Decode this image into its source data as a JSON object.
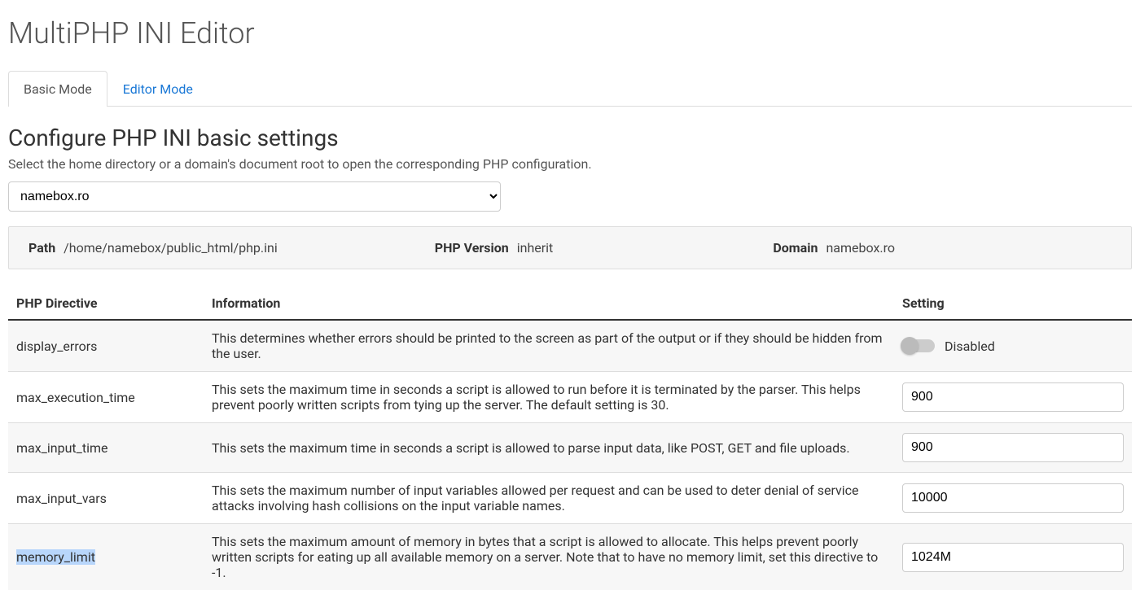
{
  "page": {
    "title": "MultiPHP INI Editor",
    "tabs": [
      {
        "label": "Basic Mode",
        "active": true
      },
      {
        "label": "Editor Mode",
        "active": false
      }
    ],
    "section_title": "Configure PHP INI basic settings",
    "helptext": "Select the home directory or a domain's document root to open the corresponding PHP configuration.",
    "domain_selected": "namebox.ro"
  },
  "info": {
    "path_label": "Path",
    "path_value": "/home/namebox/public_html/php.ini",
    "version_label": "PHP Version",
    "version_value": "inherit",
    "domain_label": "Domain",
    "domain_value": "namebox.ro"
  },
  "table": {
    "headers": {
      "directive": "PHP Directive",
      "information": "Information",
      "setting": "Setting"
    },
    "rows": [
      {
        "directive": "display_errors",
        "info": "This determines whether errors should be printed to the screen as part of the output or if they should be hidden from the user.",
        "type": "toggle",
        "value": "Disabled",
        "highlighted": false
      },
      {
        "directive": "max_execution_time",
        "info": "This sets the maximum time in seconds a script is allowed to run before it is terminated by the parser. This helps prevent poorly written scripts from tying up the server. The default setting is 30.",
        "type": "text",
        "value": "900",
        "highlighted": false
      },
      {
        "directive": "max_input_time",
        "info": "This sets the maximum time in seconds a script is allowed to parse input data, like POST, GET and file uploads.",
        "type": "text",
        "value": "900",
        "highlighted": false
      },
      {
        "directive": "max_input_vars",
        "info": "This sets the maximum number of input variables allowed per request and can be used to deter denial of service attacks involving hash collisions on the input variable names.",
        "type": "text",
        "value": "10000",
        "highlighted": false
      },
      {
        "directive": "memory_limit",
        "info": "This sets the maximum amount of memory in bytes that a script is allowed to allocate. This helps prevent poorly written scripts for eating up all available memory on a server. Note that to have no memory limit, set this directive to -1.",
        "type": "text",
        "value": "1024M",
        "highlighted": true
      }
    ]
  }
}
